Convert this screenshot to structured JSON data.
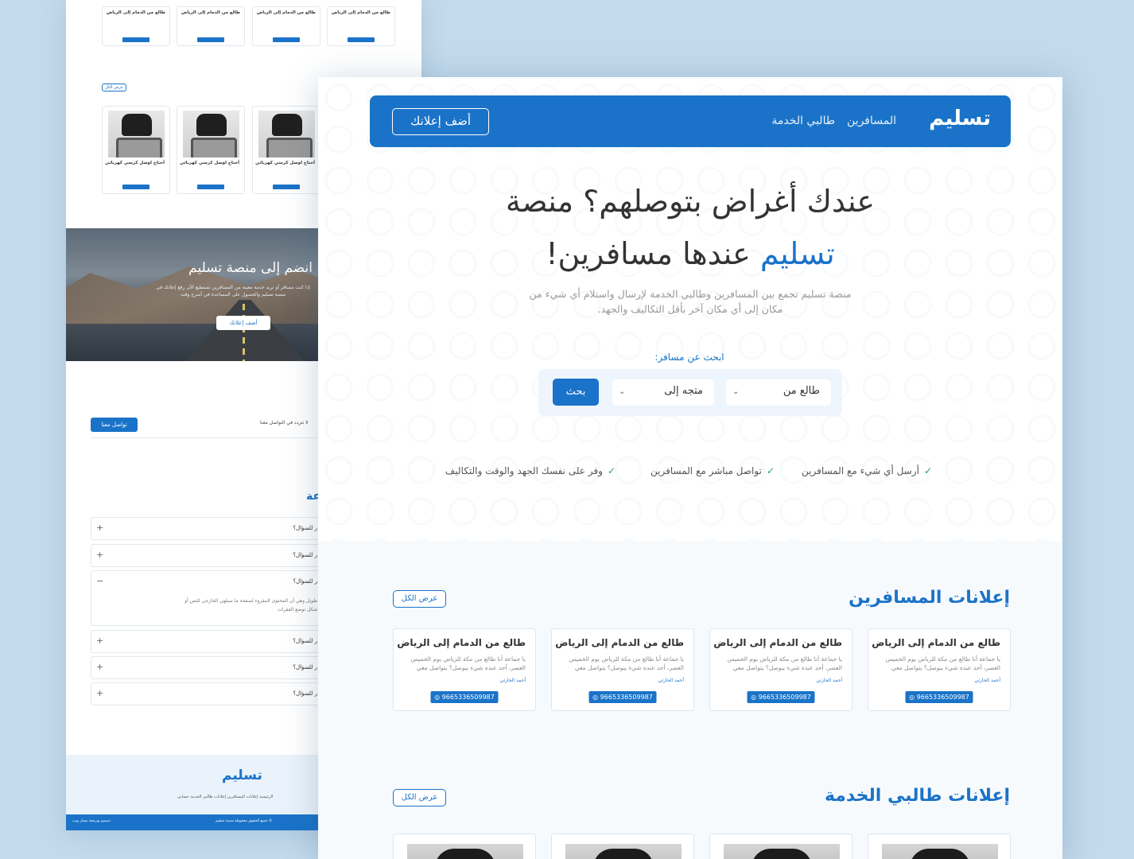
{
  "back": {
    "mini_cards": [
      {
        "title": "طالع من الدمام إلى الرياض"
      },
      {
        "title": "طالع من الدمام إلى الرياض"
      },
      {
        "title": "طالع من الدمام إلى الرياض"
      },
      {
        "title": "طالع من الدمام إلى الرياض"
      }
    ],
    "view_all": "عرض الكل",
    "products": [
      {
        "title": "أحتاج اوصل كرسي كهربائي"
      },
      {
        "title": "أحتاج اوصل كرسي كهربائي"
      },
      {
        "title": "أحتاج اوصل كرسي كهربائي"
      }
    ],
    "join": {
      "title": "انضم إلى منصة تسليم",
      "text": "إذا كنت مسافر أو تريد خدمة معينة من المسافرين تستطيع الآن رفع إعلانك في منصة تسليم والحصول على المساعدة في أسرع وقت",
      "button": "أضف إعلانك"
    },
    "contact": {
      "text": "لا تتردد في التواصل معنا",
      "button": "تواصل معنا",
      "icon": "?"
    },
    "faq_heading": "عة",
    "faq": [
      {
        "q": "ر للسؤال؟",
        "toggle": "+"
      },
      {
        "q": "ر للسؤال؟",
        "toggle": "+"
      },
      {
        "q": "ر للسؤال؟",
        "toggle": "−",
        "answer": "طويل وهي أن المحتوى المقروء لصفحة ما سيلهي الخارجي للنص أو شكل توضع الفقرات"
      },
      {
        "q": "ر للسؤال؟",
        "toggle": "+"
      },
      {
        "q": "ر للسؤال؟",
        "toggle": "+"
      },
      {
        "q": "ر للسؤال؟",
        "toggle": "+"
      }
    ],
    "footer": {
      "logo": "تسليم",
      "links": "الرئيسية     إعلانات المسافرين     إعلانات طالبي الخدمة     حسابي",
      "copyright": "© جميع الحقوق محفوظة منصة تسليم",
      "design": "تصميم وبرمجة مسار ويب"
    }
  },
  "nav": {
    "logo": "تسليم",
    "travelers": "المسافرين",
    "requesters": "طالبي الخدمة",
    "add_ad": "أضف إعلانك"
  },
  "hero": {
    "line1": "عندك أغراض بتوصلهم؟ منصة",
    "line2_accent": "تسليم",
    "line2_rest": " عندها مسافرين!",
    "subtitle": "منصة تسليم تجمع بين المسافرين وطالبي الخدمة لإرسال واستلام أي شيء من مكان إلى أي مكان آخر بأقل التكاليف والجهد."
  },
  "search": {
    "label": "ابحث عن مسافر:",
    "from": "طالع من",
    "to": "متجه إلى",
    "button": "بحث"
  },
  "features": [
    "أرسل أي شيء مع المسافرين",
    "تواصل مباشر مع المسافرين",
    "وفر على نفسك الجهد والوقت والتكاليف"
  ],
  "travelers_section": {
    "title": "إعلانات المسافرين",
    "view_all": "عرض الكل",
    "cards": [
      {
        "title": "طالع من الدمام إلى الرياض",
        "text": "يا جماعة أنا طالع من مكة للرياض يوم الخميس العصر، أحد عنده شيء يبوصل؟ يتواصل معي",
        "author": "أحمد الحارثي",
        "phone": "9665336509987"
      },
      {
        "title": "طالع من الدمام إلى الرياض",
        "text": "يا جماعة أنا طالع من مكة للرياض يوم الخميس العصر، أحد عنده شيء يبوصل؟ يتواصل معي",
        "author": "أحمد الحارثي",
        "phone": "9665336509987"
      },
      {
        "title": "طالع من الدمام إلى الرياض",
        "text": "يا جماعة أنا طالع من مكة للرياض يوم الخميس العصر، أحد عنده شيء يبوصل؟ يتواصل معي",
        "author": "أحمد الحارثي",
        "phone": "9665336509987"
      },
      {
        "title": "طالع من الدمام إلى الرياض",
        "text": "يا جماعة أنا طالع من مكة للرياض يوم الخميس العصر، أحد عنده شيء يبوصل؟ يتواصل معي",
        "author": "أحمد الحارثي",
        "phone": "9665336509987"
      }
    ]
  },
  "requesters_section": {
    "title": "إعلانات طالبي الخدمة",
    "view_all": "عرض الكل"
  },
  "icons": {
    "check": "check-icon",
    "whatsapp": "whatsapp-icon",
    "chevron": "chevron-down-icon"
  },
  "colors": {
    "primary": "#1a73c8",
    "check": "#2e9e6e",
    "backdrop": "#c3daec"
  }
}
